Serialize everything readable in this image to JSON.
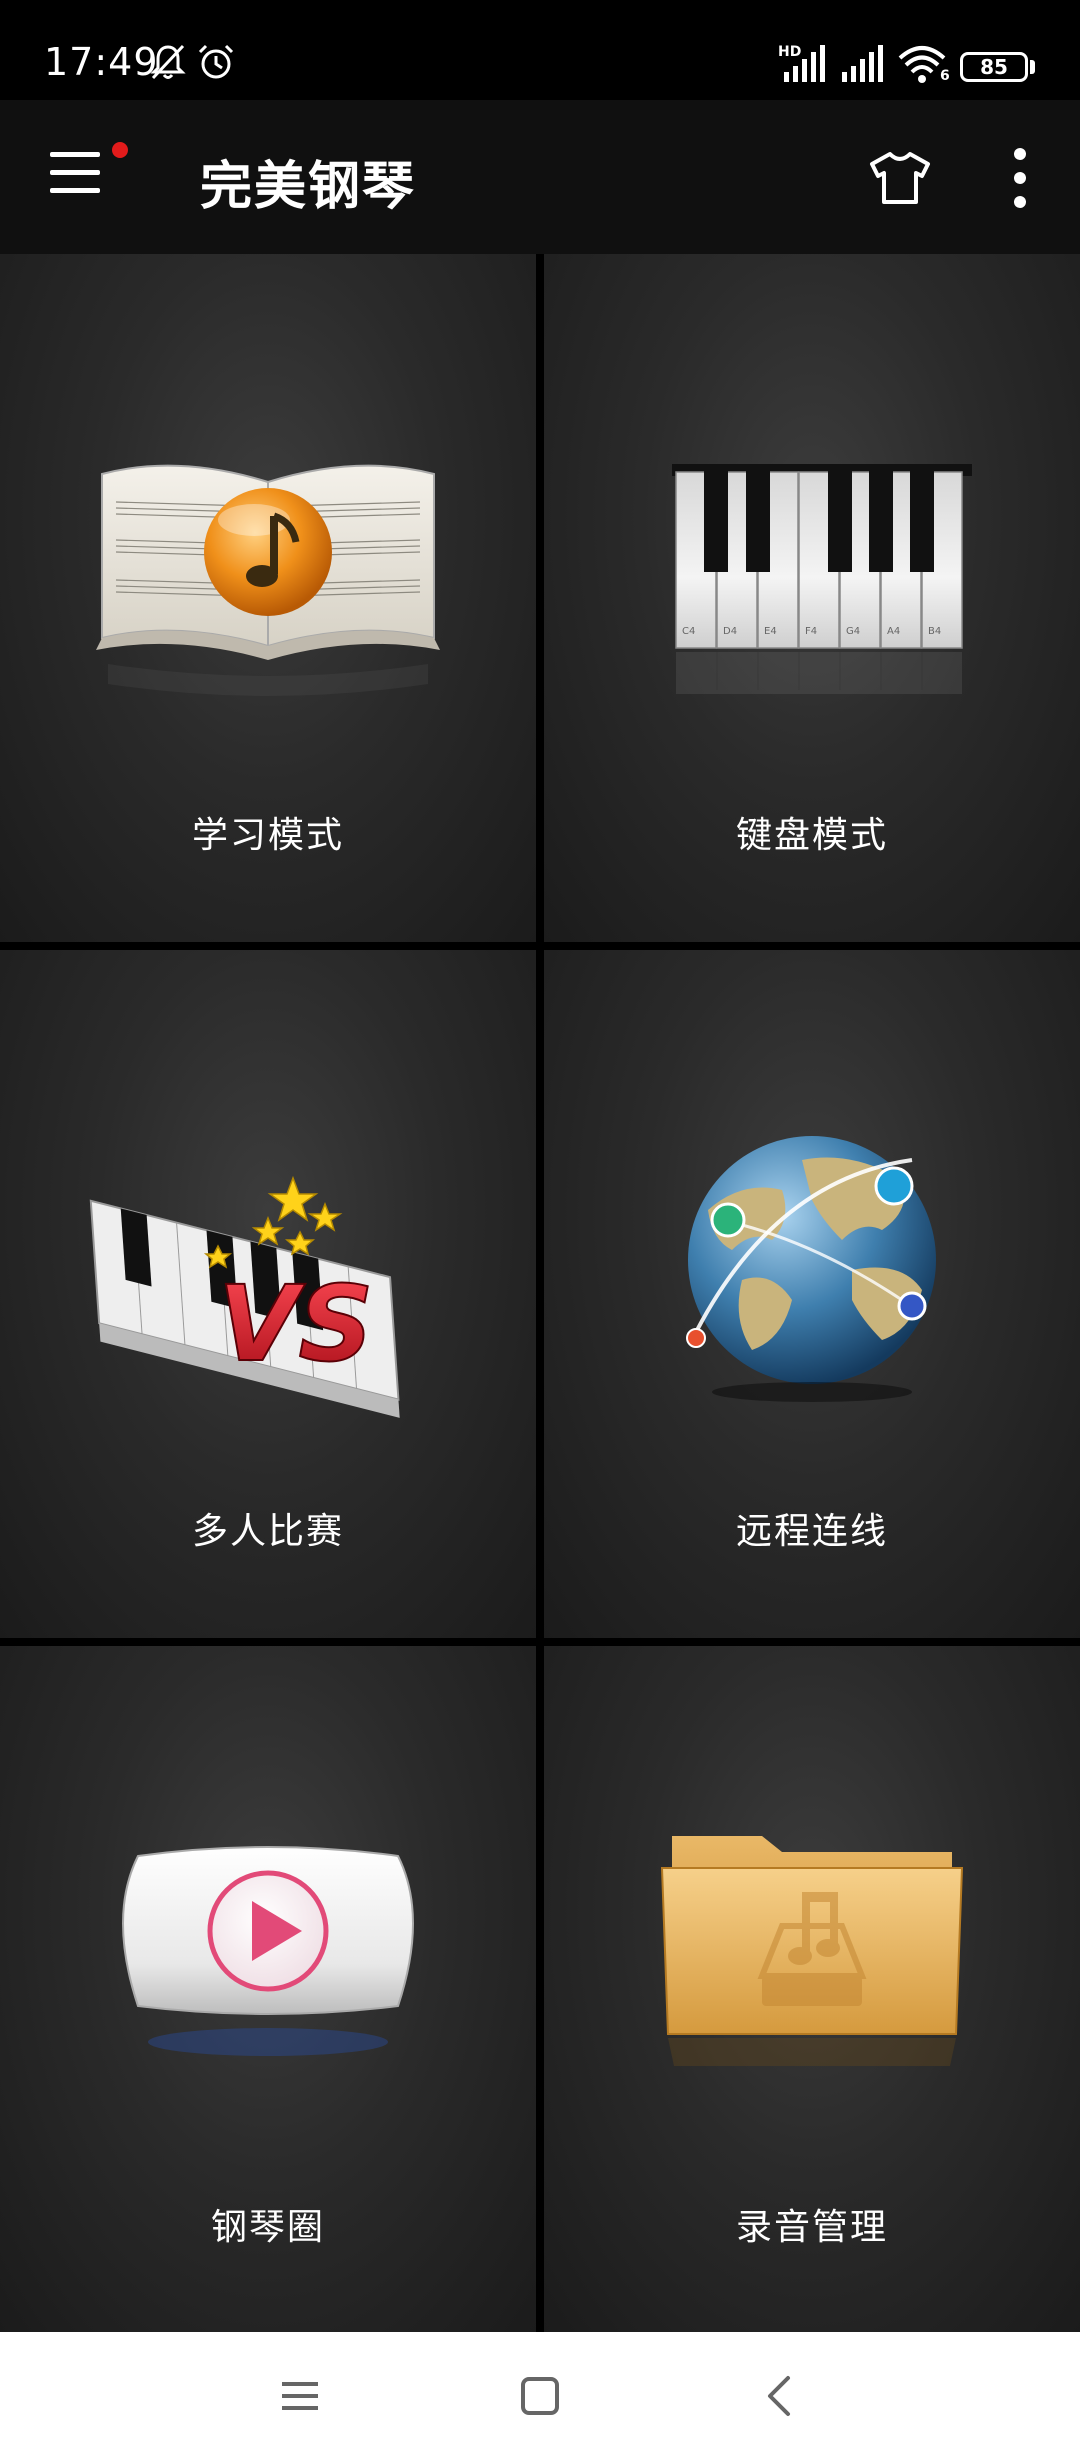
{
  "status_bar": {
    "time": "17:49",
    "icons": [
      "mute-bell-icon",
      "alarm-icon",
      "hd-signal-icon",
      "signal-icon",
      "wifi-icon"
    ],
    "wifi_label": "6",
    "hd_label": "HD",
    "battery": "85"
  },
  "app_bar": {
    "title": "完美钢琴",
    "notification_dot_color": "#e21b1b"
  },
  "tiles": [
    {
      "label": "学习模式",
      "icon": "sheet-music-book-icon"
    },
    {
      "label": "键盘模式",
      "icon": "piano-keyboard-icon"
    },
    {
      "label": "多人比赛",
      "icon": "piano-vs-icon"
    },
    {
      "label": "远程连线",
      "icon": "globe-network-icon"
    },
    {
      "label": "钢琴圈",
      "icon": "play-video-icon"
    },
    {
      "label": "录音管理",
      "icon": "music-folder-icon"
    }
  ],
  "keyboard_note_labels": [
    "C4",
    "D4",
    "E4",
    "F4",
    "G4",
    "A4",
    "B4"
  ],
  "vs_text": "VS",
  "nav_bar": {
    "icons": [
      "recents-icon",
      "home-icon",
      "back-icon"
    ]
  }
}
